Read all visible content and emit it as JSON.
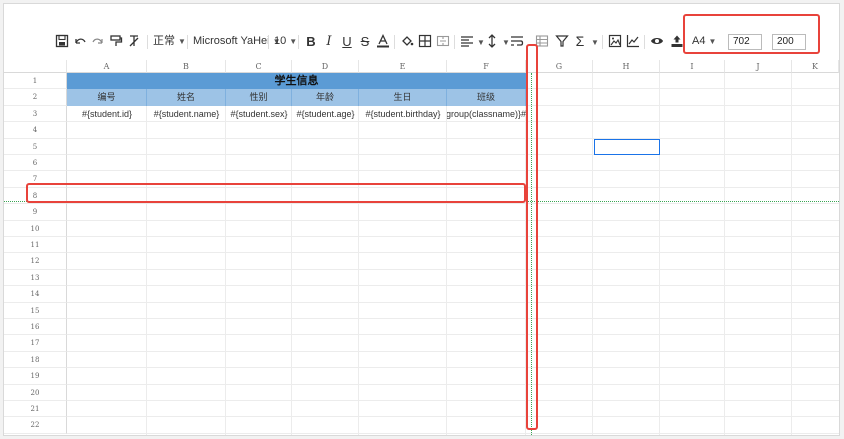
{
  "toolbar": {
    "style_select": "正常",
    "font_select": "Microsoft YaHei",
    "size_select": "10",
    "paper_select": "A4",
    "page_width": "702",
    "page_height": "200"
  },
  "columns": [
    "A",
    "B",
    "C",
    "D",
    "E",
    "F",
    "G",
    "H",
    "I",
    "J",
    "K"
  ],
  "rows": [
    "1",
    "2",
    "3",
    "4",
    "5",
    "6",
    "7",
    "8",
    "9",
    "10",
    "11",
    "12",
    "13",
    "14",
    "15",
    "16",
    "17",
    "18",
    "19",
    "20",
    "21",
    "22"
  ],
  "sheet": {
    "title": "学生信息",
    "headers": [
      "编号",
      "姓名",
      "性别",
      "年龄",
      "生日",
      "班级"
    ],
    "fields": [
      "#{student.id}",
      "#{student.name}",
      "#{student.sex}",
      "#{student.age}",
      "#{student.birthday}",
      "#{student.group(classname)}"
    ]
  },
  "colors": {
    "title_bg": "#5b9bd5",
    "header_bg": "#9dc3e6",
    "highlight": "#e8433b",
    "page_break": "#3aa655",
    "selection": "#1a73e8"
  }
}
